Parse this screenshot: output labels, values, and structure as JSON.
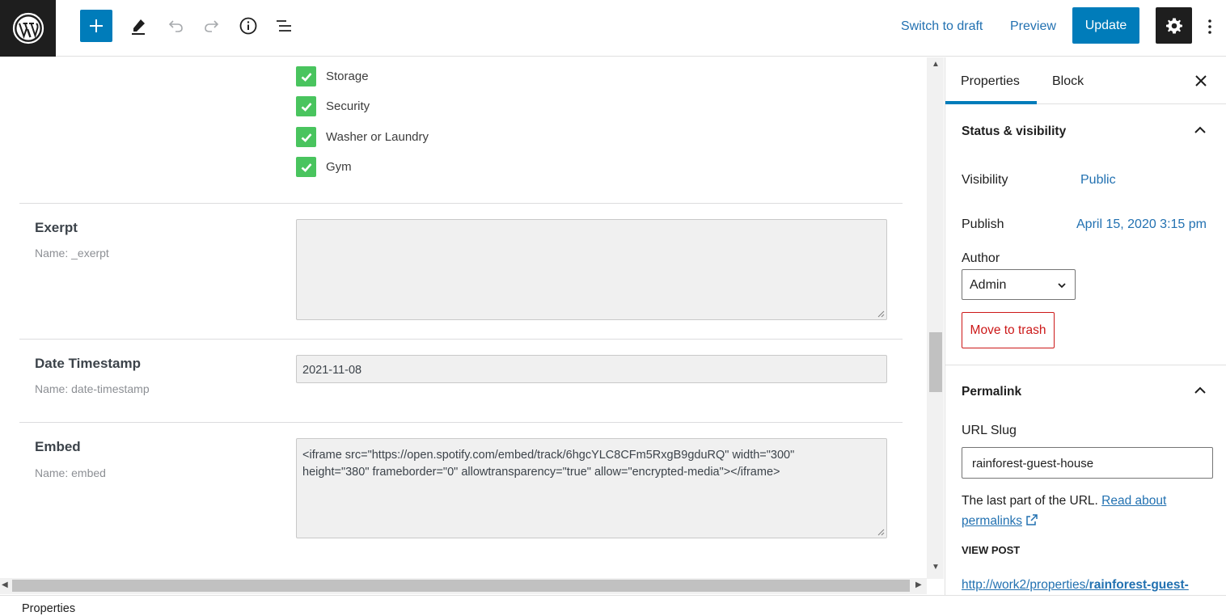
{
  "topbar": {
    "switch_to_draft": "Switch to draft",
    "preview": "Preview",
    "update": "Update"
  },
  "checkboxes": [
    {
      "label": "Storage",
      "checked": true
    },
    {
      "label": "Security",
      "checked": true
    },
    {
      "label": "Washer or Laundry",
      "checked": true
    },
    {
      "label": "Gym",
      "checked": true
    }
  ],
  "fields": {
    "exerpt": {
      "label": "Exerpt",
      "name": "Name: _exerpt",
      "value": ""
    },
    "date": {
      "label": "Date Timestamp",
      "name": "Name: date-timestamp",
      "value": "2021-11-08"
    },
    "embed": {
      "label": "Embed",
      "name": "Name: embed",
      "value": "<iframe src=\"https://open.spotify.com/embed/track/6hgcYLC8CFm5RxgB9gduRQ\" width=\"300\" height=\"380\" frameborder=\"0\" allowtransparency=\"true\" allow=\"encrypted-media\"></iframe>"
    }
  },
  "sidebar": {
    "tabs": {
      "properties": "Properties",
      "block": "Block"
    },
    "status_panel": {
      "title": "Status & visibility",
      "visibility_label": "Visibility",
      "visibility_value": "Public",
      "publish_label": "Publish",
      "publish_value": "April 15, 2020 3:15 pm",
      "author_label": "Author",
      "author_value": "Admin",
      "trash": "Move to trash"
    },
    "permalink_panel": {
      "title": "Permalink",
      "slug_label": "URL Slug",
      "slug_value": "rainforest-guest-house",
      "help_prefix": "The last part of the URL.",
      "help_link": "Read about permalinks",
      "view_post": "VIEW POST",
      "url_prefix": "http://work2/properties/",
      "url_slug": "rainforest-guest-"
    }
  },
  "footer": {
    "label": "Properties"
  },
  "colors": {
    "accent": "#007cba",
    "check": "#49c45e",
    "danger": "#cc1818",
    "link": "#2271b1"
  }
}
